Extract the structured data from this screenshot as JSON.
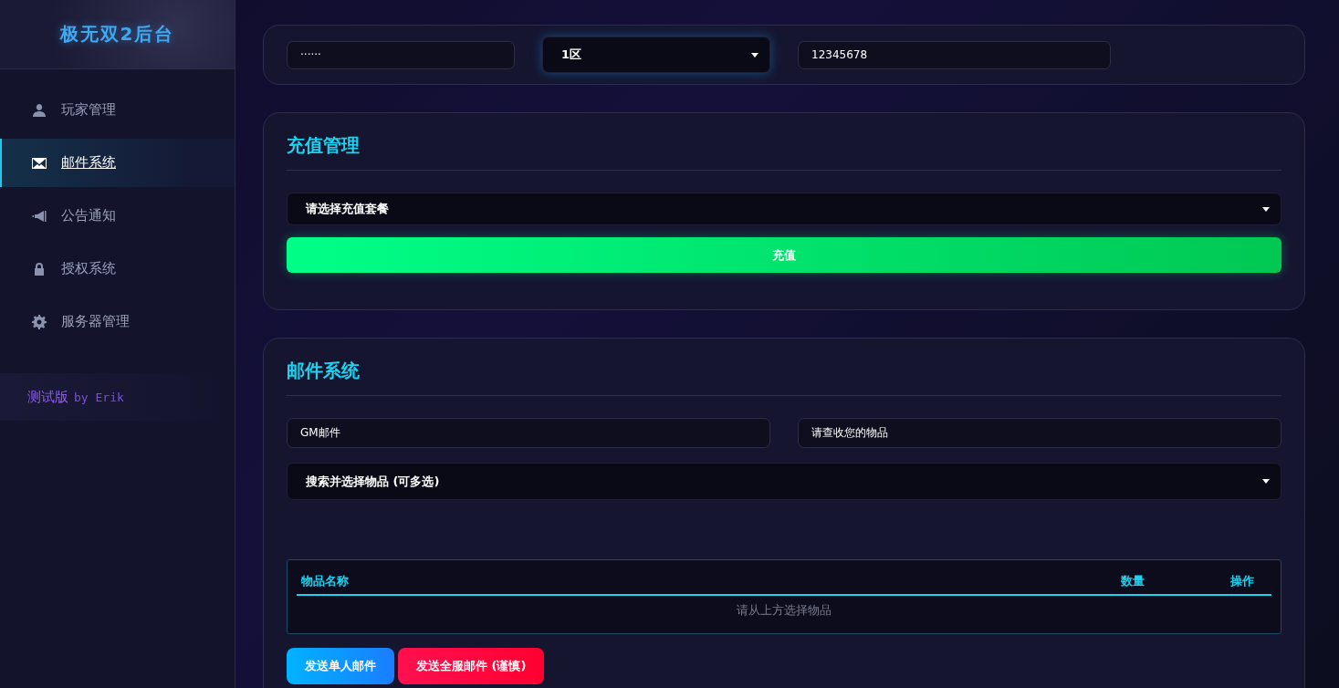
{
  "sidebar": {
    "title": "极无双2后台",
    "items": [
      {
        "label": "玩家管理",
        "selected": false
      },
      {
        "label": "邮件系统",
        "selected": true
      },
      {
        "label": "公告通知",
        "selected": false
      },
      {
        "label": "授权系统",
        "selected": false
      },
      {
        "label": "服务器管理",
        "selected": false
      }
    ],
    "footer": {
      "label": "测试版",
      "author": "by Erik"
    }
  },
  "login_bar": {
    "password": "······",
    "server_select": "1区",
    "account": "12345678"
  },
  "recharge": {
    "title": "充值管理",
    "package_select": "请选择充值套餐",
    "submit_button": "充值"
  },
  "mail": {
    "title": "邮件系统",
    "sender": "GM邮件",
    "subject": "请查收您的物品",
    "item_select": "搜索并选择物品 (可多选)",
    "table": {
      "columns": [
        "物品名称",
        "数量",
        "操作"
      ],
      "empty_text": "请从上方选择物品"
    },
    "buttons": [
      {
        "label": "发送单人邮件",
        "kind": "primary"
      },
      {
        "label": "发送全服邮件 (谨慎)",
        "kind": "danger"
      }
    ]
  }
}
